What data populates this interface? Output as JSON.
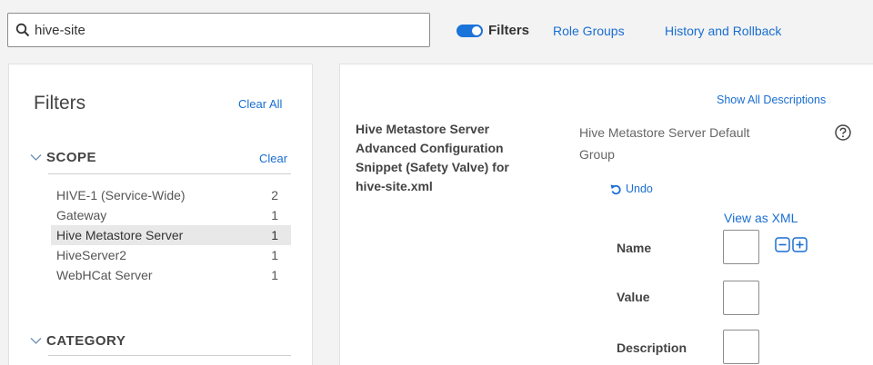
{
  "search": {
    "value": "hive-site"
  },
  "toolbar": {
    "filters_label": "Filters",
    "role_groups": "Role Groups",
    "history": "History and Rollback"
  },
  "filters_panel": {
    "title": "Filters",
    "clear_all": "Clear All",
    "scope": {
      "heading": "SCOPE",
      "clear": "Clear",
      "items": [
        {
          "label": "HIVE-1 (Service-Wide)",
          "count": "2"
        },
        {
          "label": "Gateway",
          "count": "1"
        },
        {
          "label": "Hive Metastore Server",
          "count": "1"
        },
        {
          "label": "HiveServer2",
          "count": "1"
        },
        {
          "label": "WebHCat Server",
          "count": "1"
        }
      ],
      "selected": "Hive Metastore Server"
    },
    "category": {
      "heading": "CATEGORY"
    }
  },
  "config": {
    "show_all": "Show All Descriptions",
    "property_lines": [
      "Hive Metastore Server",
      "Advanced Configuration",
      "Snippet (Safety Valve) for",
      "hive-site.xml"
    ],
    "scope_line1": "Hive Metastore Server Default",
    "scope_line2": "Group",
    "undo": "Undo",
    "view_xml": "View as XML",
    "fields": {
      "name": "Name",
      "value": "Value",
      "description": "Description"
    }
  },
  "colors": {
    "accent": "#1a73d9",
    "link": "#1a6ed0"
  }
}
